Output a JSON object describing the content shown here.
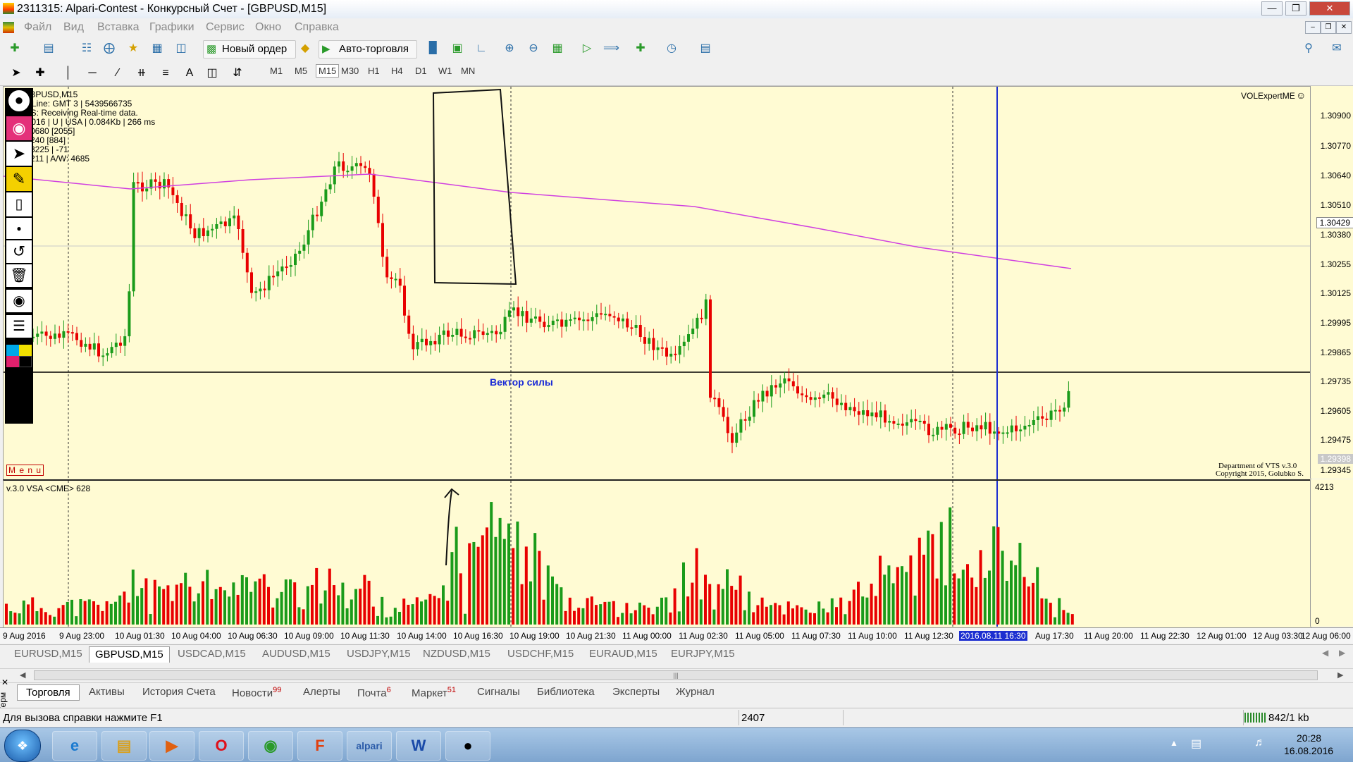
{
  "window": {
    "title": "2311315: Alpari-Contest - Конкурсный Счет - [GBPUSD,M15]"
  },
  "menu": [
    "Файл",
    "Вид",
    "Вставка",
    "Графики",
    "Сервис",
    "Окно",
    "Справка"
  ],
  "toolbar": {
    "new_order": "Новый ордер",
    "auto_trading": "Авто-торговля"
  },
  "timeframes": [
    "M1",
    "M5",
    "M15",
    "M30",
    "H1",
    "H4",
    "D1",
    "W1",
    "MN"
  ],
  "timeframe_active": "M15",
  "chart": {
    "symbol_header": "GBPUSD,M15",
    "info_lines": [
      "e Line: GMT 3 | 5439566735",
      "DS:  Receiving Real-time data.",
      "13/9/2016 | U | USA | 0.084Kb | 266 ms",
      "0680 [2055]",
      "240  [884]",
      "3225 | -71",
      "211 | A/W: 4685"
    ],
    "expert_name": "VOLExpertME",
    "annotation": "Вектор силы",
    "menu_label": "M e n u",
    "copyright1": "Department of VTS  v.3.0",
    "copyright2": "Copyright 2015, Golubko S.",
    "price_labels": [
      "1.30900",
      "1.30770",
      "1.30640",
      "1.30510",
      "1.30380",
      "1.30255",
      "1.30125",
      "1.29995",
      "1.29865",
      "1.29735",
      "1.29605",
      "1.29475",
      "1.29345"
    ],
    "current_price": "1.30429",
    "low_price_label": "1.29398",
    "volume_indicator_label": "v.3.0 VSA <CME> 628",
    "volume_scale_top": "4213",
    "volume_scale_bottom": "0",
    "time_labels": [
      "9 Aug 2016",
      "9 Aug 23:00",
      "10 Aug 01:30",
      "10 Aug 04:00",
      "10 Aug 06:30",
      "10 Aug 09:00",
      "10 Aug 11:30",
      "10 Aug 14:00",
      "10 Aug 16:30",
      "10 Aug 19:00",
      "10 Aug 21:30",
      "11 Aug 00:00",
      "11 Aug 02:30",
      "11 Aug 05:00",
      "11 Aug 07:30",
      "11 Aug 10:00",
      "11 Aug 12:30",
      "2016.08.11 16:30",
      "Aug 17:30",
      "11 Aug 20:00",
      "11 Aug 22:30",
      "12 Aug 01:00",
      "12 Aug 03:30",
      "12 Aug 06:00"
    ]
  },
  "symbol_tabs": [
    "EURUSD,M15",
    "GBPUSD,M15",
    "USDCAD,M15",
    "AUDUSD,M15",
    "USDJPY,M15",
    "NZDUSD,M15",
    "USDCHF,M15",
    "EURAUD,M15",
    "EURJPY,M15"
  ],
  "symbol_tab_active": "GBPUSD,M15",
  "terminal": {
    "side_label": "Терм",
    "tabs": [
      {
        "label": "Торговля",
        "badge": ""
      },
      {
        "label": "Активы",
        "badge": ""
      },
      {
        "label": "История Счета",
        "badge": ""
      },
      {
        "label": "Новости",
        "badge": "99"
      },
      {
        "label": "Алерты",
        "badge": ""
      },
      {
        "label": "Почта",
        "badge": "6"
      },
      {
        "label": "Маркет",
        "badge": "51"
      },
      {
        "label": "Сигналы",
        "badge": ""
      },
      {
        "label": "Библиотека",
        "badge": ""
      },
      {
        "label": "Эксперты",
        "badge": ""
      },
      {
        "label": "Журнал",
        "badge": ""
      }
    ]
  },
  "status": {
    "help": "Для вызова справки нажмите F1",
    "bars": "2407",
    "traffic": "842/1 kb"
  },
  "taskbar": {
    "time": "20:28",
    "date": "16.08.2016",
    "apps": [
      "start-orb",
      "internet-explorer",
      "file-explorer",
      "media-player",
      "opera",
      "chrome",
      "file-manager",
      "alpari",
      "word",
      "metatrader"
    ]
  },
  "colors": {
    "chart_bg": "#fffbd3",
    "bull": "#1a9b1a",
    "bear": "#e80000",
    "ma_line": "#d040e0",
    "vline": "#1c2ed0",
    "annotation": "#1a2ad6"
  }
}
